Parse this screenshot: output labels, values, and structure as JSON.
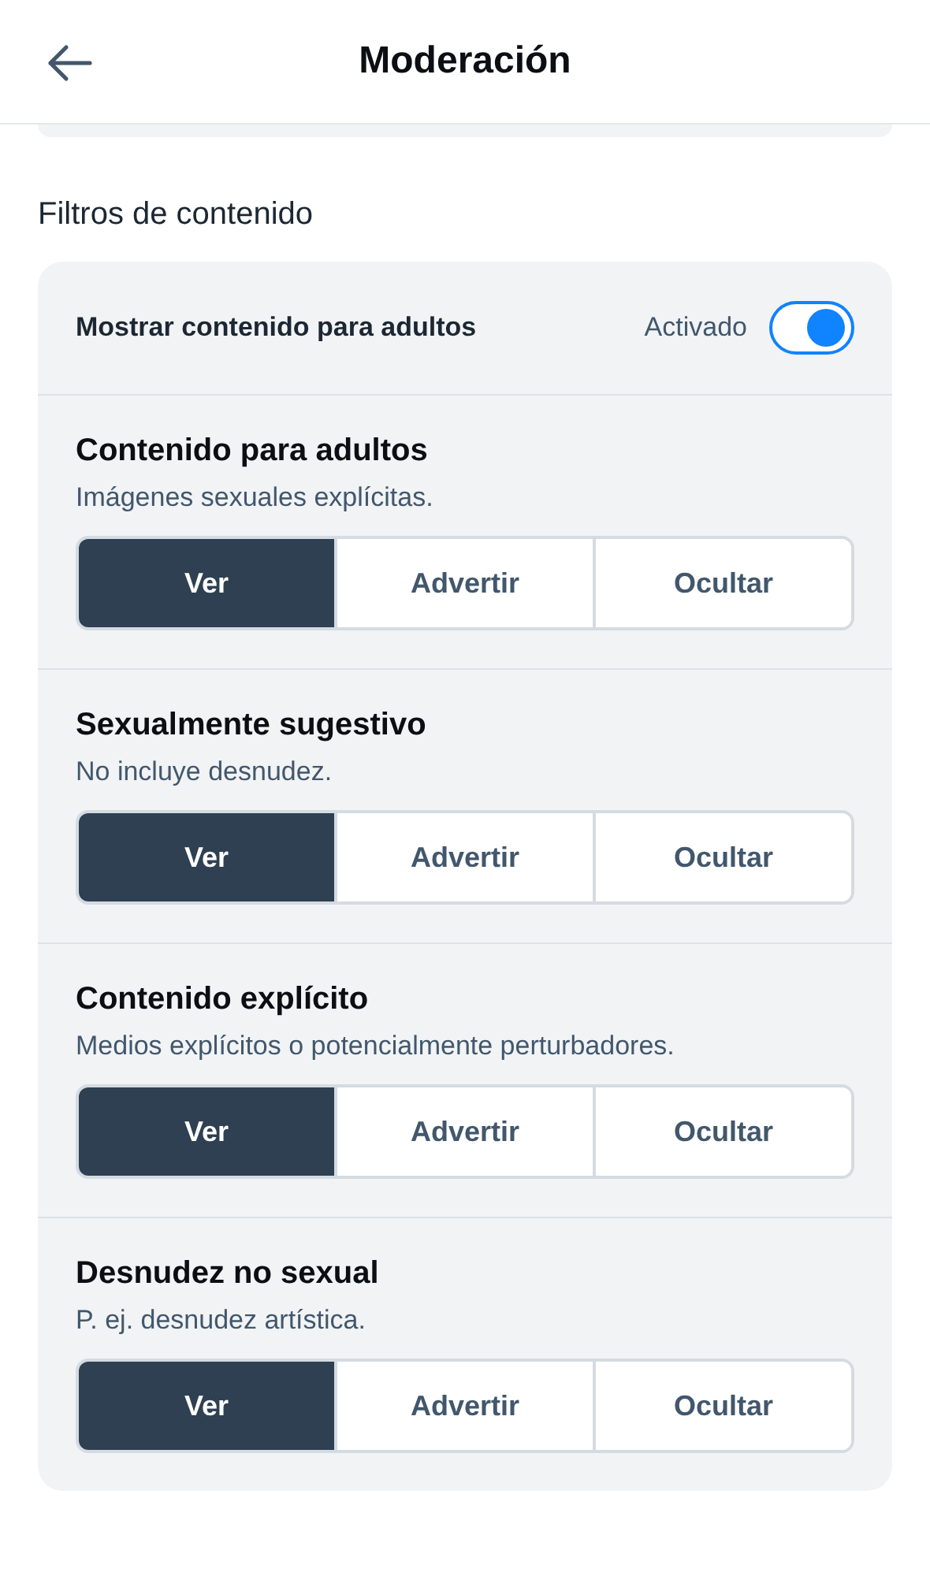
{
  "header": {
    "title": "Moderación"
  },
  "section": {
    "title": "Filtros de contenido"
  },
  "adult_toggle": {
    "label": "Mostrar contenido para adultos",
    "status": "Activado",
    "on": true
  },
  "filters": [
    {
      "title": "Contenido para adultos",
      "description": "Imágenes sexuales explícitas.",
      "options": [
        {
          "label": "Ver",
          "selected": true
        },
        {
          "label": "Advertir",
          "selected": false
        },
        {
          "label": "Ocultar",
          "selected": false
        }
      ]
    },
    {
      "title": "Sexualmente sugestivo",
      "description": "No incluye desnudez.",
      "options": [
        {
          "label": "Ver",
          "selected": true
        },
        {
          "label": "Advertir",
          "selected": false
        },
        {
          "label": "Ocultar",
          "selected": false
        }
      ]
    },
    {
      "title": "Contenido explícito",
      "description": "Medios explícitos o potencialmente perturbadores.",
      "options": [
        {
          "label": "Ver",
          "selected": true
        },
        {
          "label": "Advertir",
          "selected": false
        },
        {
          "label": "Ocultar",
          "selected": false
        }
      ]
    },
    {
      "title": "Desnudez no sexual",
      "description": "P. ej. desnudez artística.",
      "options": [
        {
          "label": "Ver",
          "selected": true
        },
        {
          "label": "Advertir",
          "selected": false
        },
        {
          "label": "Ocultar",
          "selected": false
        }
      ]
    }
  ]
}
